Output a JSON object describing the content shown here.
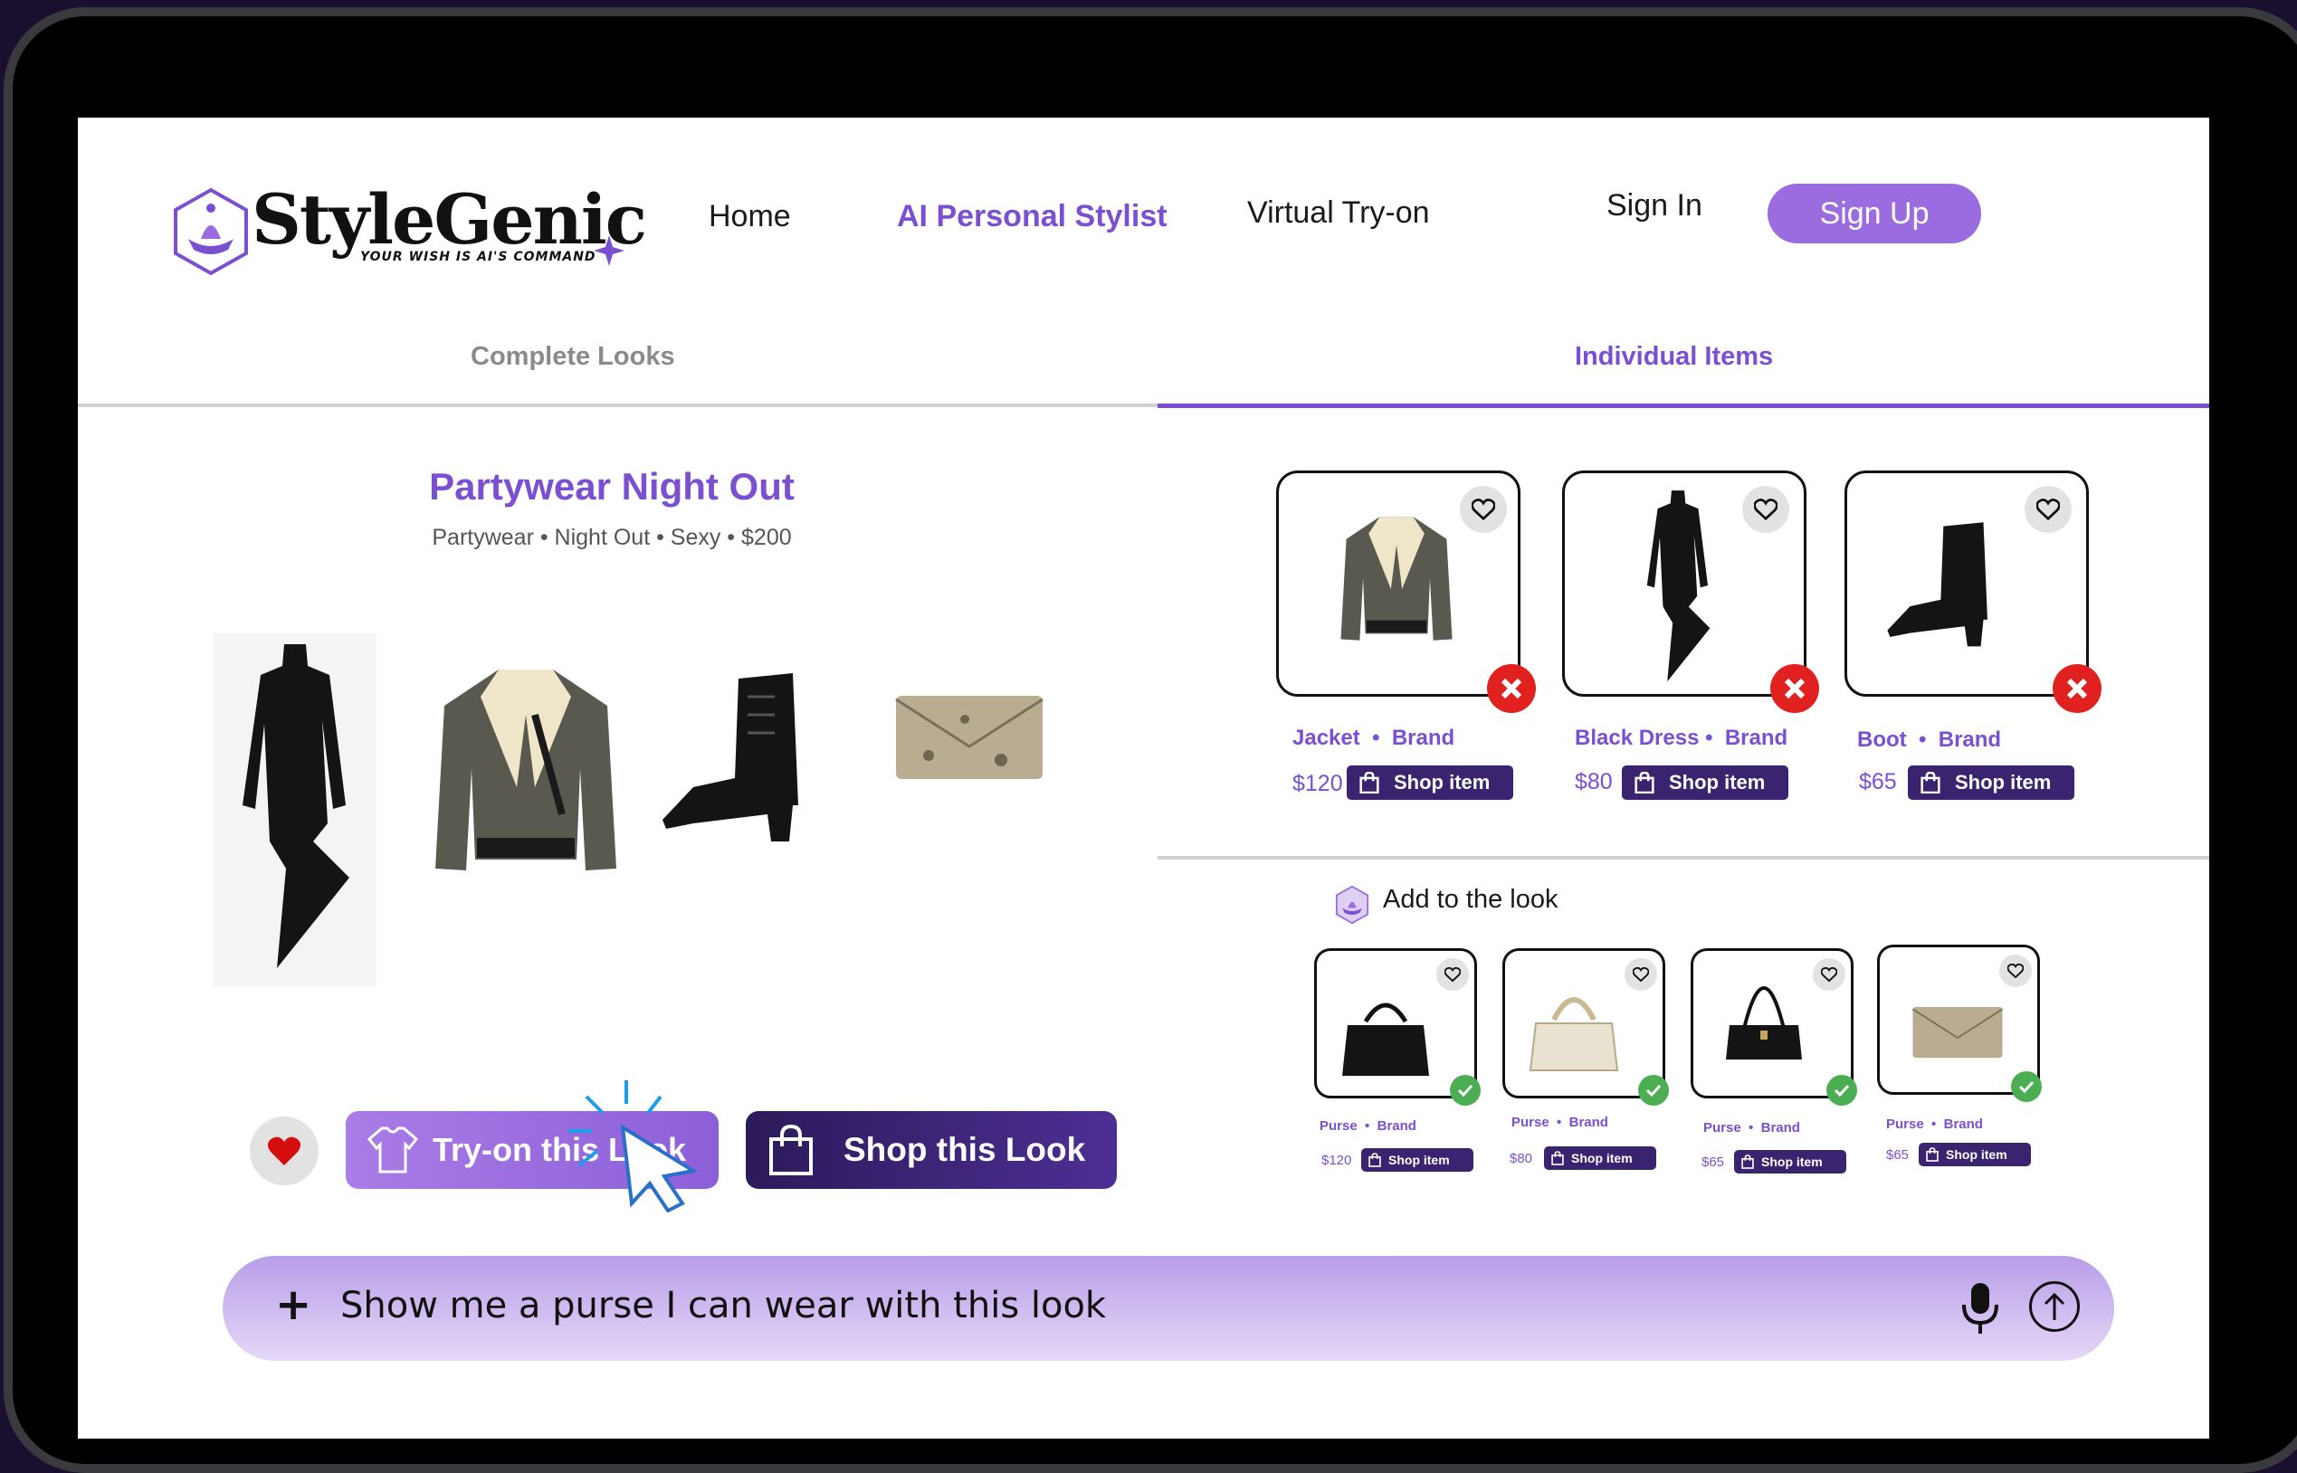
{
  "brand": {
    "name": "StyleGenic",
    "tagline": "YOUR WISH IS AI'S COMMAND",
    "accent": "#7b4fd1"
  },
  "nav": {
    "home": "Home",
    "ai_stylist": "AI Personal Stylist",
    "virtual_tryon": "Virtual Try-on",
    "sign_in": "Sign In",
    "sign_up": "Sign Up"
  },
  "tabs": {
    "complete_looks": "Complete Looks",
    "individual_items": "Individual Items",
    "active": "Individual Items"
  },
  "look": {
    "title": "Partywear Night Out",
    "tags": "Partywear • Night Out • Sexy • $200",
    "try_on_label": "Try-on this Look",
    "shop_label": "Shop this Look",
    "favorited": true
  },
  "items": [
    {
      "name": "Jacket",
      "brand": "Brand",
      "price": "$120",
      "shop_label": "Shop item",
      "icon": "jacket-icon"
    },
    {
      "name": "Black Dress",
      "brand": "Brand",
      "price": "$80",
      "shop_label": "Shop item",
      "icon": "dress-icon"
    },
    {
      "name": "Boot",
      "brand": "Brand",
      "price": "$65",
      "shop_label": "Shop item",
      "icon": "boot-icon"
    }
  ],
  "add_to_look": {
    "label": "Add to the look",
    "items": [
      {
        "name": "Purse",
        "brand": "Brand",
        "price": "$120",
        "shop_label": "Shop item",
        "icon": "black-purse-icon"
      },
      {
        "name": "Purse",
        "brand": "Brand",
        "price": "$80",
        "shop_label": "Shop item",
        "icon": "white-purse-icon"
      },
      {
        "name": "Purse",
        "brand": "Brand",
        "price": "$65",
        "shop_label": "Shop item",
        "icon": "shoulder-bag-icon"
      },
      {
        "name": "Purse",
        "brand": "Brand",
        "price": "$65",
        "shop_label": "Shop item",
        "icon": "clutch-icon"
      }
    ]
  },
  "chat": {
    "input_value": "Show me a purse I can wear with this look"
  }
}
